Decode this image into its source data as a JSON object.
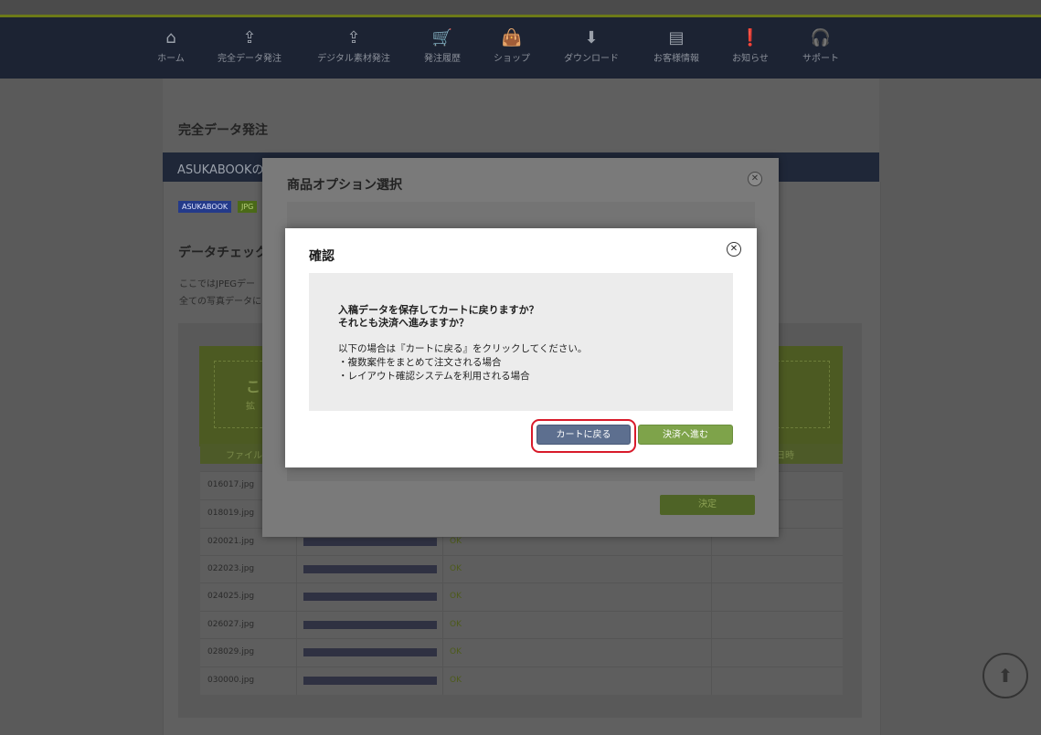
{
  "nav": {
    "items": [
      {
        "label": "ホーム",
        "icon": "home-icon",
        "glyph": "⌂"
      },
      {
        "label": "完全データ発注",
        "icon": "upload-tray-icon",
        "glyph": "⇪"
      },
      {
        "label": "デジタル素材発注",
        "icon": "upload-photo-icon",
        "glyph": "⇪"
      },
      {
        "label": "発注履歴",
        "icon": "cart-icon",
        "glyph": "🛒"
      },
      {
        "label": "ショップ",
        "icon": "shopping-bag-icon",
        "glyph": "👜"
      },
      {
        "label": "ダウンロード",
        "icon": "download-icon",
        "glyph": "⬇"
      },
      {
        "label": "お客様情報",
        "icon": "document-icon",
        "glyph": "▤"
      },
      {
        "label": "お知らせ",
        "icon": "alert-icon",
        "glyph": "❗"
      },
      {
        "label": "サポート",
        "icon": "headset-icon",
        "glyph": "🎧"
      }
    ]
  },
  "page": {
    "title": "完全データ発注",
    "section_head": "ASUKABOOKの",
    "tags": [
      "ASUKABOOK",
      "JPG"
    ],
    "sub_title": "データチェック",
    "intro": [
      "ここではJPEGデー",
      "全ての写真データに"
    ],
    "drop_title": "こ",
    "drop_sub": "拡",
    "table_head": {
      "file": "ファイル",
      "date": "日時"
    },
    "rows": [
      {
        "file": "016017.jpg",
        "status": ""
      },
      {
        "file": "018019.jpg",
        "status": ""
      },
      {
        "file": "020021.jpg",
        "status": "OK"
      },
      {
        "file": "022023.jpg",
        "status": "OK"
      },
      {
        "file": "024025.jpg",
        "status": "OK"
      },
      {
        "file": "026027.jpg",
        "status": "OK"
      },
      {
        "file": "028029.jpg",
        "status": "OK"
      },
      {
        "file": "030000.jpg",
        "status": "OK"
      }
    ]
  },
  "option_modal": {
    "title": "商品オプション選択",
    "confirm_label": "決定"
  },
  "dialog": {
    "title": "確認",
    "question1": "入稿データを保存してカートに戻りますか？",
    "question2": "それとも決済へ進みますか？",
    "note": "以下の場合は『カートに戻る』をクリックしてください。",
    "case1": "・複数案件をまとめて注文される場合",
    "case2": "・レイアウト確認システムを利用される場合",
    "back_to_cart": "カートに戻る",
    "proceed_payment": "決済へ進む"
  },
  "colors": {
    "accent_green": "#7ea34a",
    "cart_button": "#5d6f8f",
    "highlight_ring": "#d81a2a",
    "navbar": "#1c2333"
  }
}
